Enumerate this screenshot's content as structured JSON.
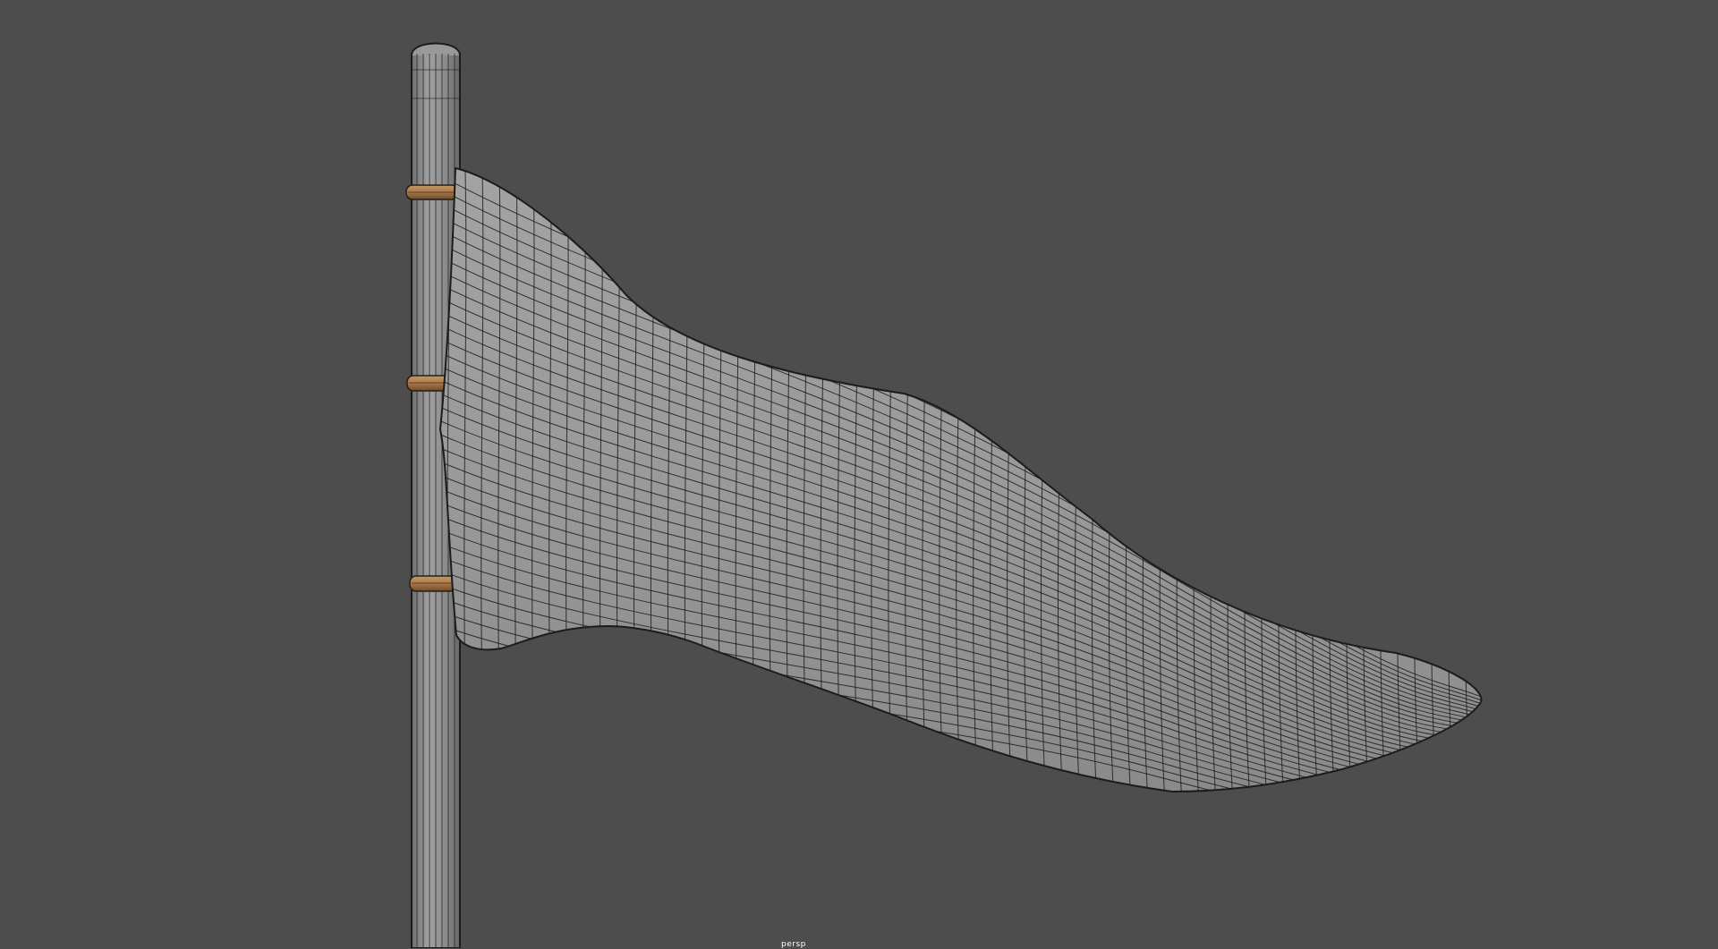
{
  "viewport": {
    "background": "#4d4d4d",
    "camera_label": "persp"
  },
  "model": {
    "flag_color": "#9a9a9a",
    "pole_color": "#8e8e8e",
    "ring_color": "#a87a4c",
    "wire_color": "#1c1c1c",
    "ring_count": 3
  }
}
